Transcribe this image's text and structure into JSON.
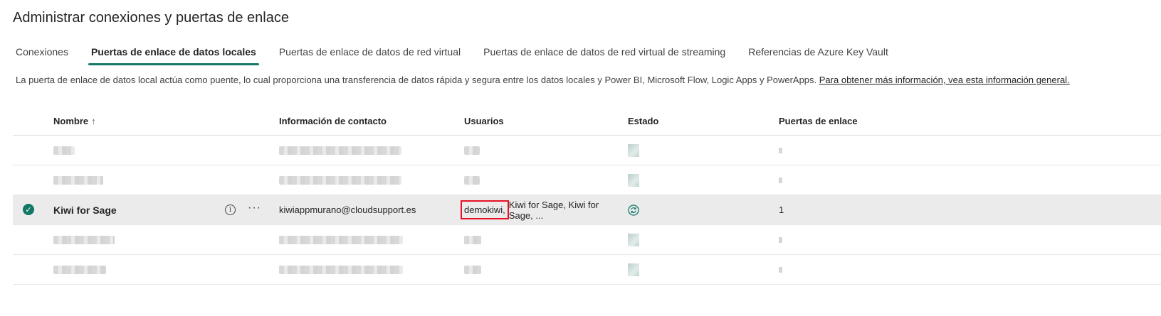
{
  "title": "Administrar conexiones y puertas de enlace",
  "tabs": [
    {
      "label": "Conexiones"
    },
    {
      "label": "Puertas de enlace de datos locales",
      "active": true
    },
    {
      "label": "Puertas de enlace de datos de red virtual"
    },
    {
      "label": "Puertas de enlace de datos de red virtual de streaming"
    },
    {
      "label": "Referencias de Azure Key Vault"
    }
  ],
  "description": {
    "text": "La puerta de enlace de datos local actúa como puente, lo cual proporciona una transferencia de datos rápida y segura entre los datos locales y Power BI, Microsoft Flow, Logic Apps y PowerApps. ",
    "link": "Para obtener más información, vea esta información general."
  },
  "table": {
    "headers": {
      "name": "Nombre",
      "contact": "Información de contacto",
      "users": "Usuarios",
      "state": "Estado",
      "gateways": "Puertas de enlace"
    },
    "selected_row": {
      "name": "Kiwi for Sage",
      "contact": "kiwiappmurano@cloudsupport.es",
      "users_highlighted": "demokiwi,",
      "users_rest": " Kiwi for Sage, Kiwi for Sage, ...",
      "gateways": "1"
    }
  },
  "icons": {
    "sort": "sort-ascending-icon",
    "check": "checkmark-circle-icon",
    "info": "info-icon",
    "more": "more-options-icon",
    "status": "refresh-status-icon"
  },
  "colors": {
    "accent": "#117865",
    "highlight_border": "#e81123",
    "selected_row": "#ebebeb"
  }
}
